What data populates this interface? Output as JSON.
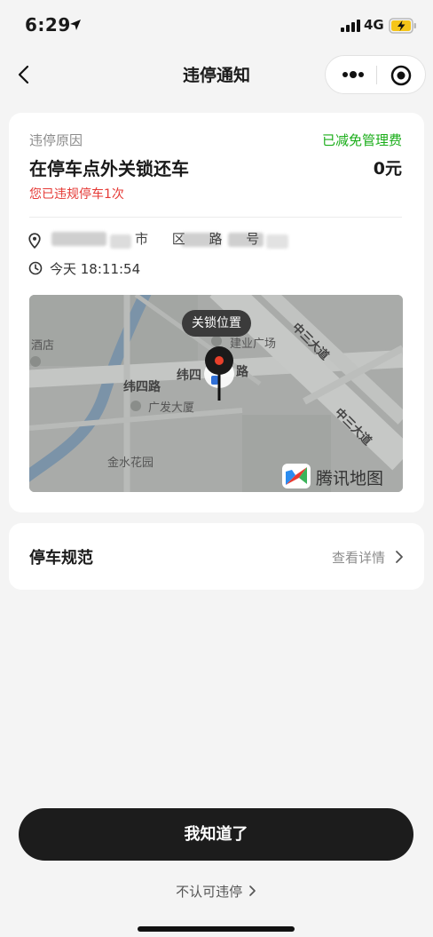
{
  "status_bar": {
    "time": "6:29",
    "network": "4G"
  },
  "nav": {
    "title": "违停通知"
  },
  "violation": {
    "reason_label": "违停原因",
    "fee_status": "已减免管理费",
    "reason": "在停车点外关锁还车",
    "fee": "0元",
    "warning": "您已违规停车1次",
    "location_visible": "市 区 路 号",
    "time": "今天 18:11:54"
  },
  "map": {
    "lock_label": "关锁位置",
    "labels": {
      "hotel": "酒店",
      "jianye": "建业广场",
      "weisi1": "纬四路",
      "weisi2": "纬四",
      "road": "路",
      "guangfa": "广发大厦",
      "jinshui": "金水花园",
      "zhongsan1": "中三大道",
      "zhongsan2": "中三大道"
    },
    "provider": "腾讯地图"
  },
  "rules": {
    "title": "停车规范",
    "link": "查看详情"
  },
  "actions": {
    "confirm": "我知道了",
    "appeal": "不认可违停"
  },
  "colors": {
    "green": "#1aad19",
    "red": "#e53935",
    "dark_button": "#1c1c1c"
  }
}
